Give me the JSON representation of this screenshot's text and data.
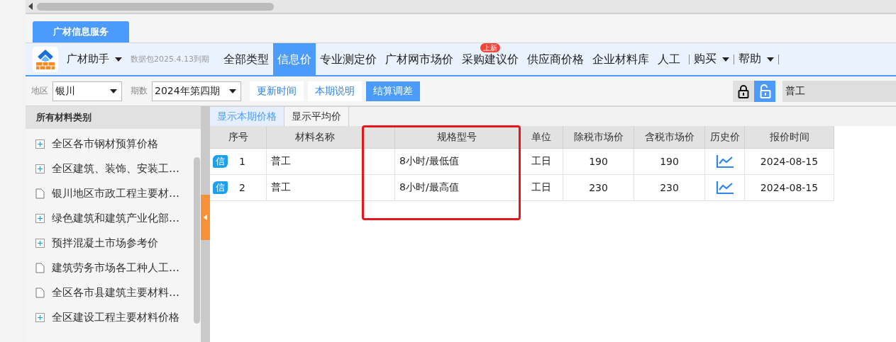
{
  "app_tab": {
    "label": "广材信息服务",
    "selected": true
  },
  "nav": {
    "app_name": "广材助手",
    "package_note": "数据包2025.4.13到期",
    "items": [
      {
        "label": "全部类型",
        "selected": false
      },
      {
        "label": "信息价",
        "selected": true
      },
      {
        "label": "专业测定价",
        "selected": false
      },
      {
        "label": "广材网市场价",
        "selected": false
      },
      {
        "label": "采购建议价",
        "selected": false,
        "badge": "上新"
      },
      {
        "label": "供应商价格",
        "selected": false
      },
      {
        "label": "企业材料库",
        "selected": false
      },
      {
        "label": "人工",
        "selected": false
      }
    ],
    "menus": [
      {
        "label": "购买"
      },
      {
        "label": "帮助"
      }
    ]
  },
  "toolbar": {
    "region_label": "地区",
    "region": "银川",
    "period_label": "期数",
    "period": "2024年第四期",
    "buttons": [
      {
        "label": "更新时间",
        "primary": false
      },
      {
        "label": "本期说明",
        "primary": false
      },
      {
        "label": "结算调差",
        "primary": true
      }
    ],
    "locked": false,
    "search": {
      "value": "普工"
    }
  },
  "sidebar": {
    "title": "所有材料类别",
    "items": [
      {
        "label": "全区各市钢材预算价格",
        "kind": "group"
      },
      {
        "label": "全区建筑、装饰、安装工…",
        "kind": "group"
      },
      {
        "label": "银川地区市政工程主要材…",
        "kind": "leaf"
      },
      {
        "label": "绿色建筑和建筑产业化部…",
        "kind": "group"
      },
      {
        "label": "预拌混凝土市场参考价",
        "kind": "group"
      },
      {
        "label": "建筑劳务市场各工种人工…",
        "kind": "leaf"
      },
      {
        "label": "全区各市县建筑主要材料…",
        "kind": "leaf"
      },
      {
        "label": "全区建设工程主要材料价格",
        "kind": "group"
      }
    ]
  },
  "view_tabs": [
    {
      "label": "显示本期价格",
      "selected": true
    },
    {
      "label": "显示平均价",
      "selected": false
    }
  ],
  "table": {
    "columns": [
      {
        "kind": "text",
        "label": "序号",
        "highlighted": false
      },
      {
        "kind": "text",
        "label": "材料名称",
        "highlighted": false
      },
      {
        "kind": "blank",
        "highlighted": true
      },
      {
        "kind": "text",
        "label": "规格型号",
        "highlighted": true
      },
      {
        "kind": "text",
        "label": "单位",
        "highlighted": false
      },
      {
        "kind": "text",
        "label": "除税市场价",
        "highlighted": false
      },
      {
        "kind": "text",
        "label": "含税市场价",
        "highlighted": false
      },
      {
        "kind": "text",
        "label": "历史价",
        "highlighted": false
      },
      {
        "kind": "text",
        "label": "报价时间",
        "highlighted": false
      }
    ],
    "rows": [
      {
        "badge": "信",
        "index": "1",
        "name": "普工",
        "spec": "8小时/最低值",
        "unit": "工日",
        "price_ex_tax": "190",
        "price_inc_tax": "190",
        "date": "2024-08-15"
      },
      {
        "badge": "信",
        "index": "2",
        "name": "普工",
        "spec": "8小时/最高值",
        "unit": "工日",
        "price_ex_tax": "230",
        "price_inc_tax": "230",
        "date": "2024-08-15"
      }
    ]
  }
}
